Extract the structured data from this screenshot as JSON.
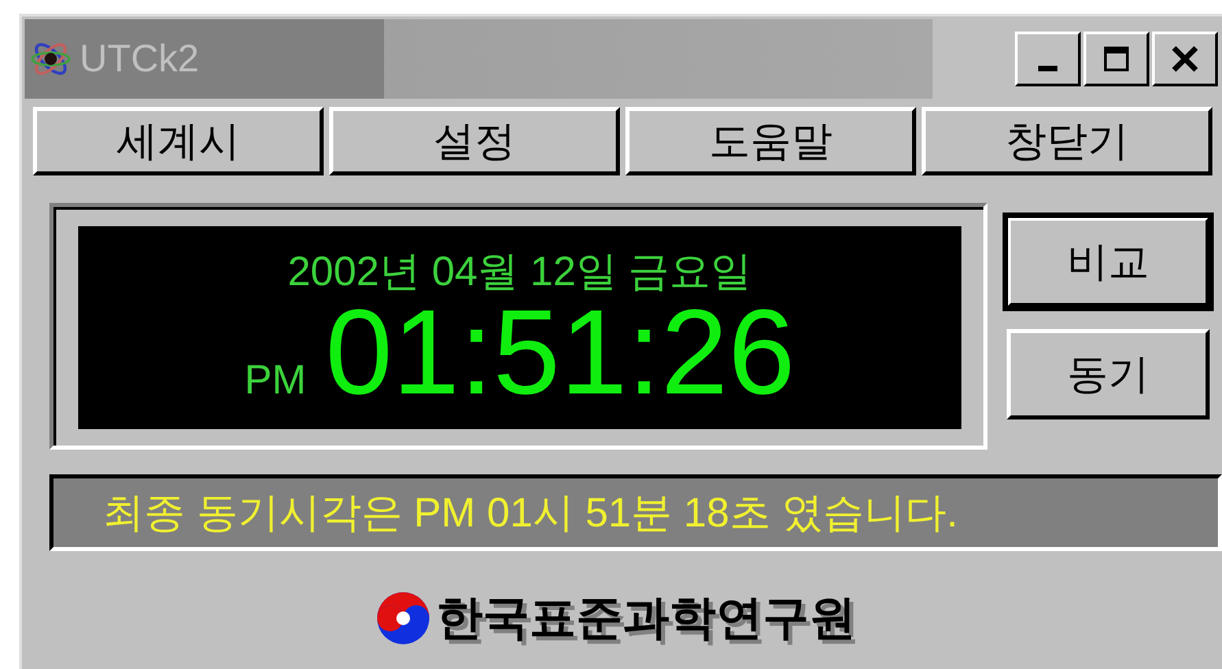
{
  "window": {
    "title": "UTCk2"
  },
  "menu_buttons": [
    {
      "label": "세계시"
    },
    {
      "label": "설정"
    },
    {
      "label": "도움말"
    },
    {
      "label": "창닫기"
    }
  ],
  "display": {
    "date": "2002년 04월 12일 금요일",
    "ampm": "PM",
    "time": "01:51:26"
  },
  "side_buttons": [
    {
      "label": "비교",
      "default": true
    },
    {
      "label": "동기",
      "default": false
    }
  ],
  "status": "최종 동기시각은 PM 01시 51분 18초 였습니다.",
  "footer": {
    "org": "한국표준과학연구원"
  }
}
